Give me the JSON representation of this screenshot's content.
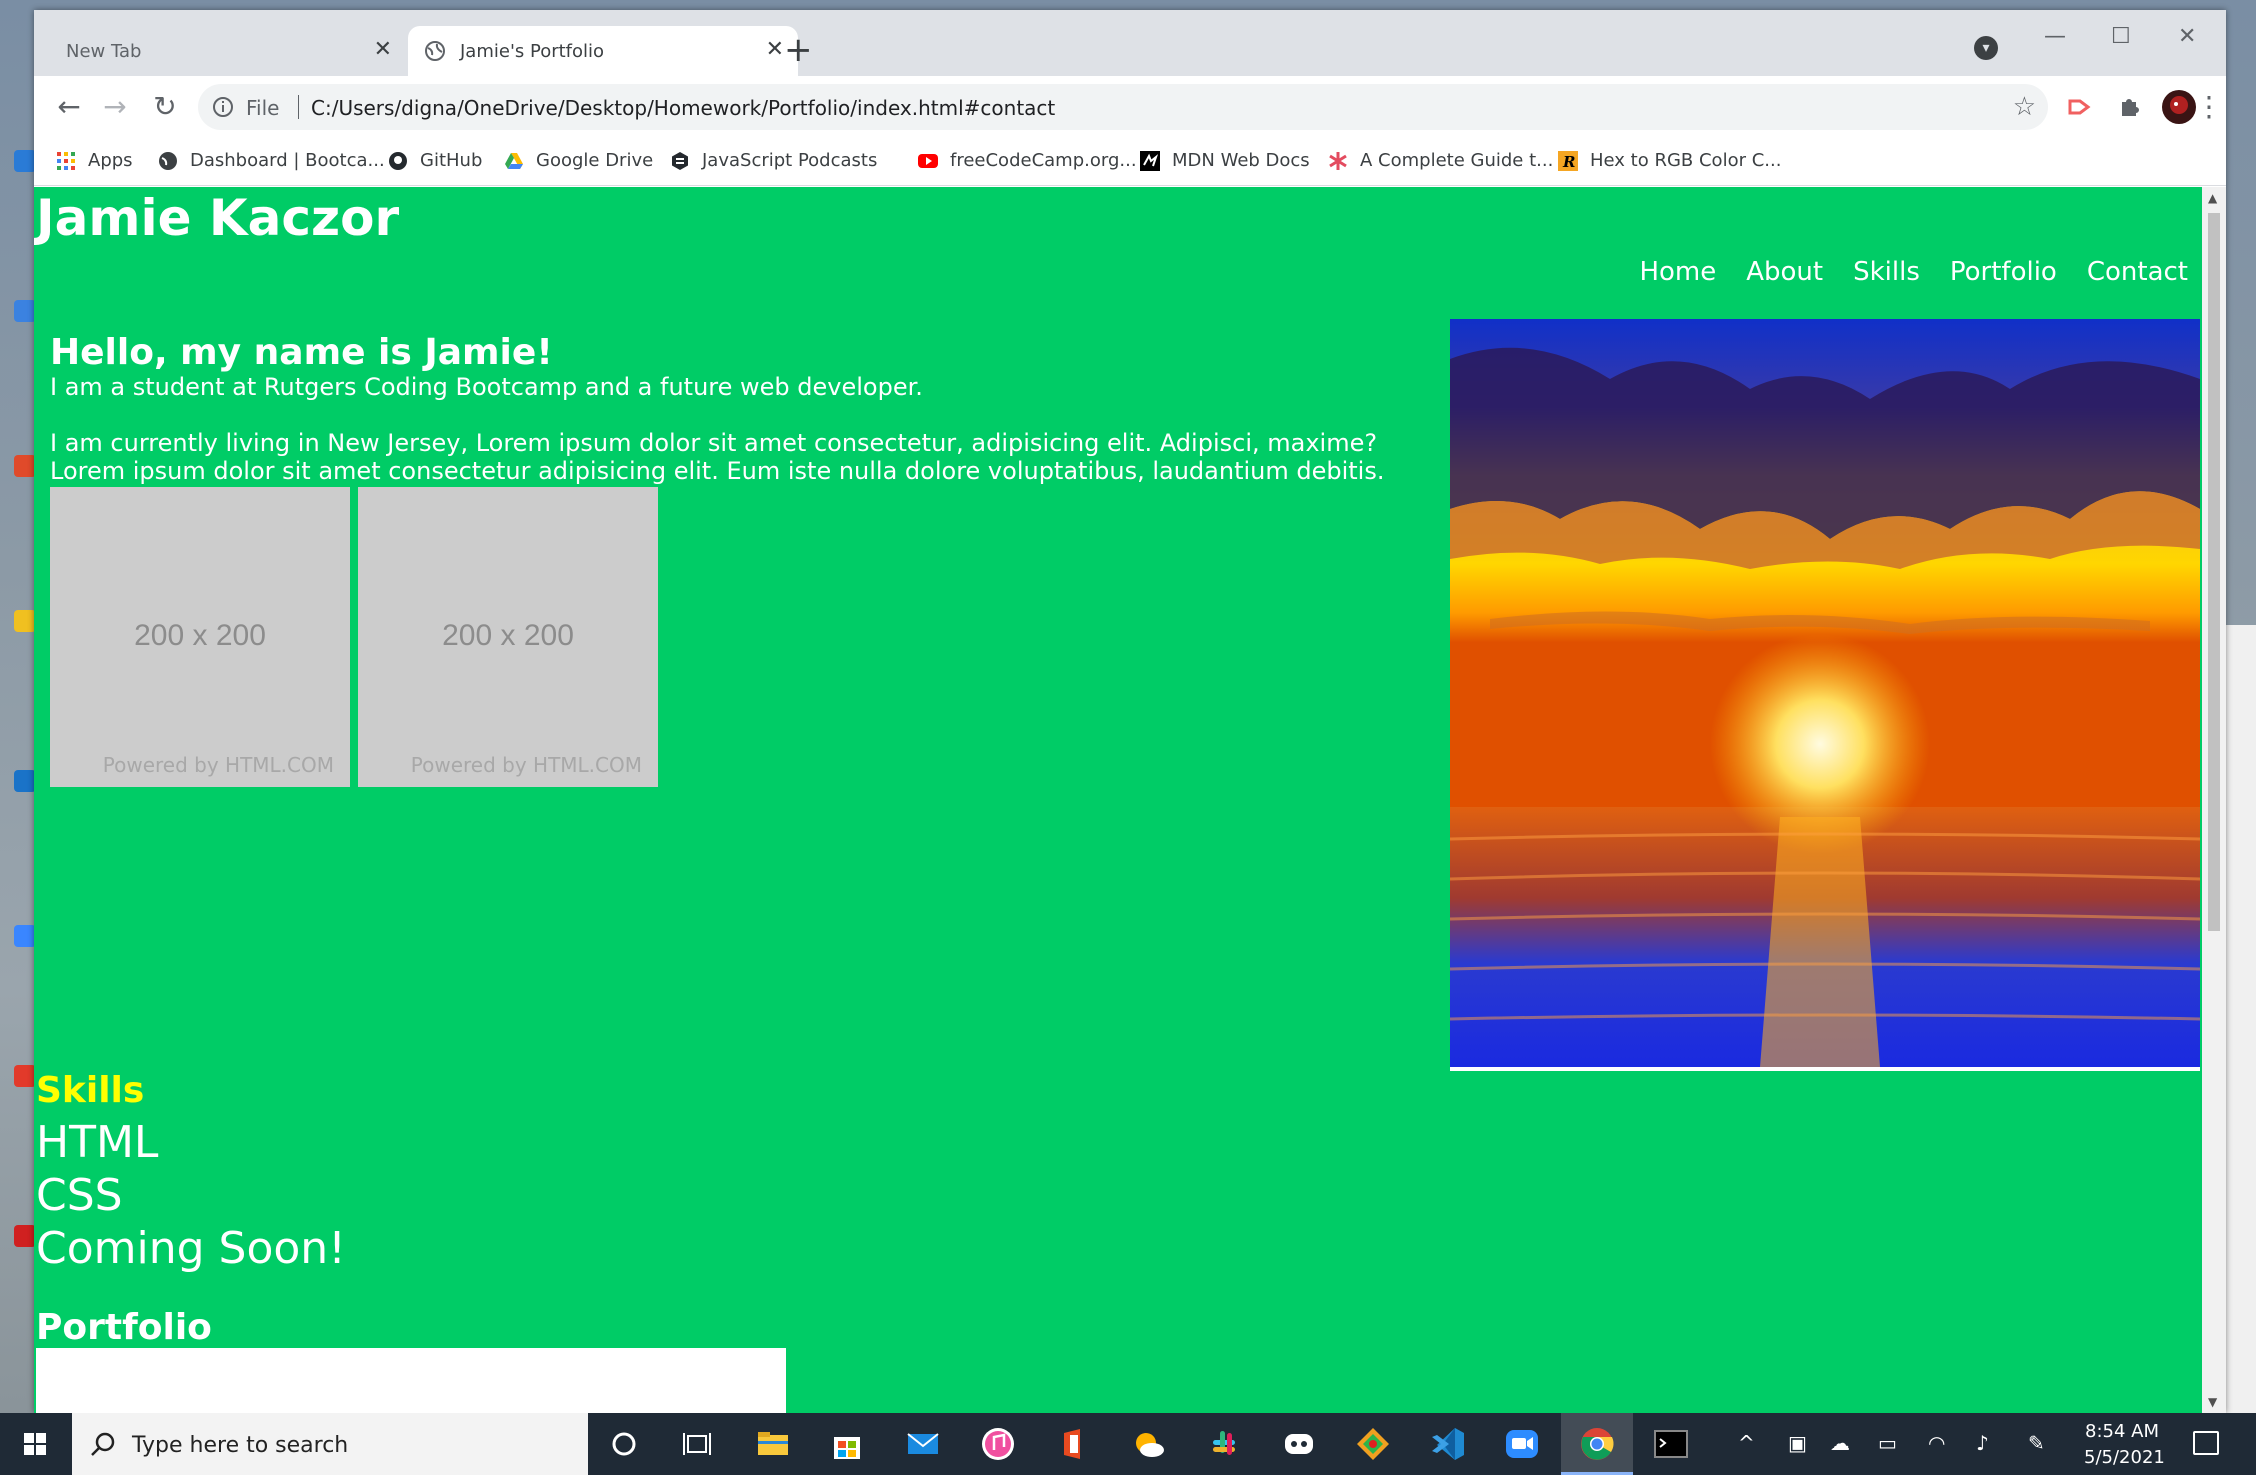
{
  "browser": {
    "tabs": [
      {
        "title": "New Tab"
      },
      {
        "title": "Jamie's Portfolio"
      }
    ],
    "file_label": "File",
    "url": "C:/Users/digna/OneDrive/Desktop/Homework/Portfolio/index.html#contact",
    "bookmarks": [
      {
        "label": "Apps",
        "icon": "apps-grid-icon"
      },
      {
        "label": "Dashboard | Bootca...",
        "icon": "globe-icon"
      },
      {
        "label": "GitHub",
        "icon": "github-icon"
      },
      {
        "label": "Google Drive",
        "icon": "google-drive-icon"
      },
      {
        "label": "JavaScript Podcasts",
        "icon": "podcast-icon"
      },
      {
        "label": "freeCodeCamp.org...",
        "icon": "youtube-icon"
      },
      {
        "label": "MDN Web Docs",
        "icon": "mdn-icon"
      },
      {
        "label": "A Complete Guide t...",
        "icon": "asterisk-icon"
      },
      {
        "label": "Hex to RGB Color C...",
        "icon": "r-logo-icon"
      }
    ]
  },
  "page": {
    "site_title": "Jamie Kaczor",
    "nav": [
      "Home",
      "About",
      "Skills",
      "Portfolio",
      "Contact"
    ],
    "hero_heading": "Hello, my name is Jamie!",
    "hero_line1": "I am a student at Rutgers Coding Bootcamp and a future web developer.",
    "hero_line2": "I am currently living in New Jersey, Lorem ipsum dolor sit amet consectetur, adipisicing elit. Adipisci, maxime? Lorem ipsum dolor sit amet consectetur adipisicing elit. Eum iste nulla dolore voluptatibus, laudantium debitis.",
    "placeholders": [
      {
        "size": "200 x 200",
        "powered": "Powered by HTML.COM"
      },
      {
        "size": "200 x 200",
        "powered": "Powered by HTML.COM"
      }
    ],
    "skills_heading": "Skills",
    "skills": [
      "HTML",
      "CSS",
      "Coming Soon!"
    ],
    "portfolio_heading": "Portfolio"
  },
  "taskbar": {
    "search_placeholder": "Type here to search",
    "time": "8:54 AM",
    "date": "5/5/2021"
  },
  "colors": {
    "page_bg": "#00cc66",
    "skills_heading": "#ffff00",
    "browser_chrome": "#dee1e6"
  }
}
